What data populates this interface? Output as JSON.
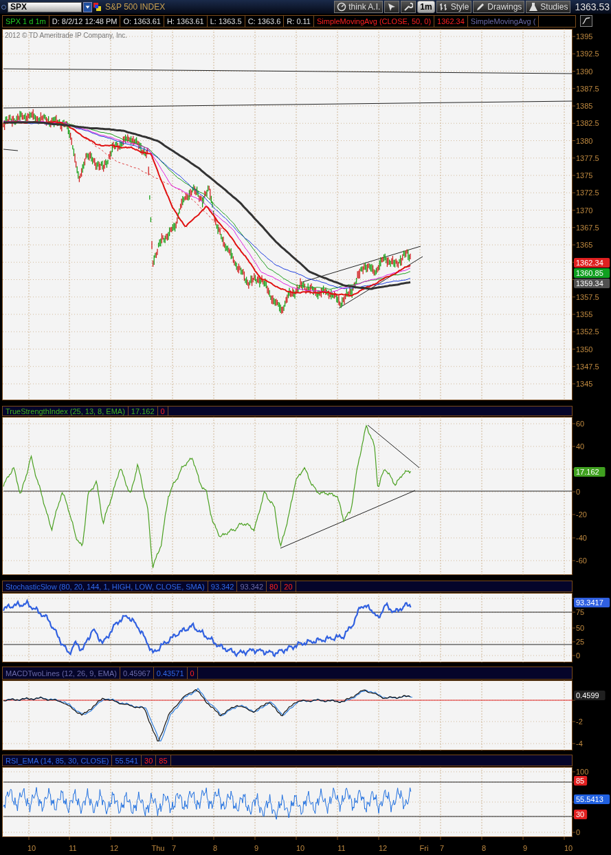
{
  "toolbar": {
    "symbol": "SPX",
    "description": "S&P 500 INDEX",
    "buttons": [
      {
        "label": "think A.I."
      },
      {
        "kind": "icon"
      },
      {
        "kind": "icon"
      },
      {
        "label": "1m"
      },
      {
        "label": "Style"
      },
      {
        "label": "Drawings"
      },
      {
        "label": "Studies"
      }
    ],
    "last_price": "1363.53"
  },
  "quote": [
    {
      "text": "SPX 1 d 1m",
      "kind": "symbol"
    },
    {
      "text": "D: 8/2/12 12:48 PM",
      "kind": "value"
    },
    {
      "text": "O: 1363.61",
      "kind": "value"
    },
    {
      "text": "H: 1363.61",
      "kind": "value"
    },
    {
      "text": "L: 1363.5",
      "kind": "value"
    },
    {
      "text": "C: 1363.6",
      "kind": "value"
    },
    {
      "text": "R: 0.11",
      "kind": "value"
    },
    {
      "text": "SimpleMovingAvg (CLOSE, 50, 0)",
      "kind": "study"
    },
    {
      "text": "1362.34",
      "kind": "study"
    },
    {
      "text": "SimpleMovingAvg (",
      "kind": "muted"
    }
  ],
  "main_chart": {
    "copyright": "2012 © TD Ameritrade IP Company, Inc.",
    "axis_labels": [
      "1395",
      "1392.5",
      "1390",
      "1387.5",
      "1385",
      "1382.5",
      "1380",
      "1377.5",
      "1375",
      "1372.5",
      "1370",
      "1367.5",
      "1365",
      "1357.5",
      "1355",
      "1352.5",
      "1350",
      "1347.5",
      "1345"
    ],
    "badges": [
      {
        "text": "1362.34",
        "color": "#e02020"
      },
      {
        "text": "1360.85",
        "color": "#10a020"
      },
      {
        "text": "1359.34",
        "color": "#505050"
      }
    ]
  },
  "studies": [
    {
      "kind": "tsi",
      "header": [
        {
          "text": "TrueStrengthIndex (25, 13, 8, EMA)",
          "kind": "name"
        },
        {
          "text": "17.162",
          "kind": "value"
        },
        {
          "text": "0",
          "kind": "level"
        }
      ],
      "axis_labels": [
        "60",
        "40",
        "0",
        "-20",
        "-40",
        "-60"
      ],
      "badges": [
        {
          "text": "17.162",
          "color": "#40a020"
        }
      ]
    },
    {
      "kind": "stochastic",
      "header": [
        {
          "text": "StochasticSlow (80, 20, 144, 1, HIGH, LOW, CLOSE, SMA)",
          "kind": "name"
        },
        {
          "text": "93.342",
          "kind": "value"
        },
        {
          "text": "93.342",
          "kind": "muted"
        },
        {
          "text": "80",
          "kind": "level"
        },
        {
          "text": "20",
          "kind": "level"
        }
      ],
      "axis_labels": [
        "75",
        "50",
        "25",
        "0"
      ],
      "badges": [
        {
          "text": "93.3417",
          "color": "#3060e0"
        }
      ]
    },
    {
      "kind": "macd",
      "header": [
        {
          "text": "MACDTwoLines (12, 26, 9, EMA)",
          "kind": "muted"
        },
        {
          "text": "0.45967",
          "kind": "muted"
        },
        {
          "text": "0.43571",
          "kind": "value"
        },
        {
          "text": "0",
          "kind": "level"
        }
      ],
      "axis_labels": [
        "-2",
        "-4"
      ],
      "badges": [
        {
          "text": "0.4599",
          "color": "#202020"
        }
      ]
    },
    {
      "kind": "rsi",
      "header": [
        {
          "text": "RSI_EMA (14, 85, 30, CLOSE)",
          "kind": "name"
        },
        {
          "text": "55.541",
          "kind": "value"
        },
        {
          "text": "30",
          "kind": "level"
        },
        {
          "text": "85",
          "kind": "level"
        }
      ],
      "axis_labels": [
        "100",
        "0"
      ],
      "badges": [
        {
          "text": "85",
          "color": "#e02020"
        },
        {
          "text": "55.5413",
          "color": "#2060e0"
        },
        {
          "text": "30",
          "color": "#e02020"
        }
      ]
    }
  ],
  "time_axis": [
    "10",
    "11",
    "12",
    "Thu",
    "7",
    "8",
    "9",
    "10",
    "11",
    "12",
    "Fri",
    "7",
    "8",
    "9",
    "10"
  ]
}
